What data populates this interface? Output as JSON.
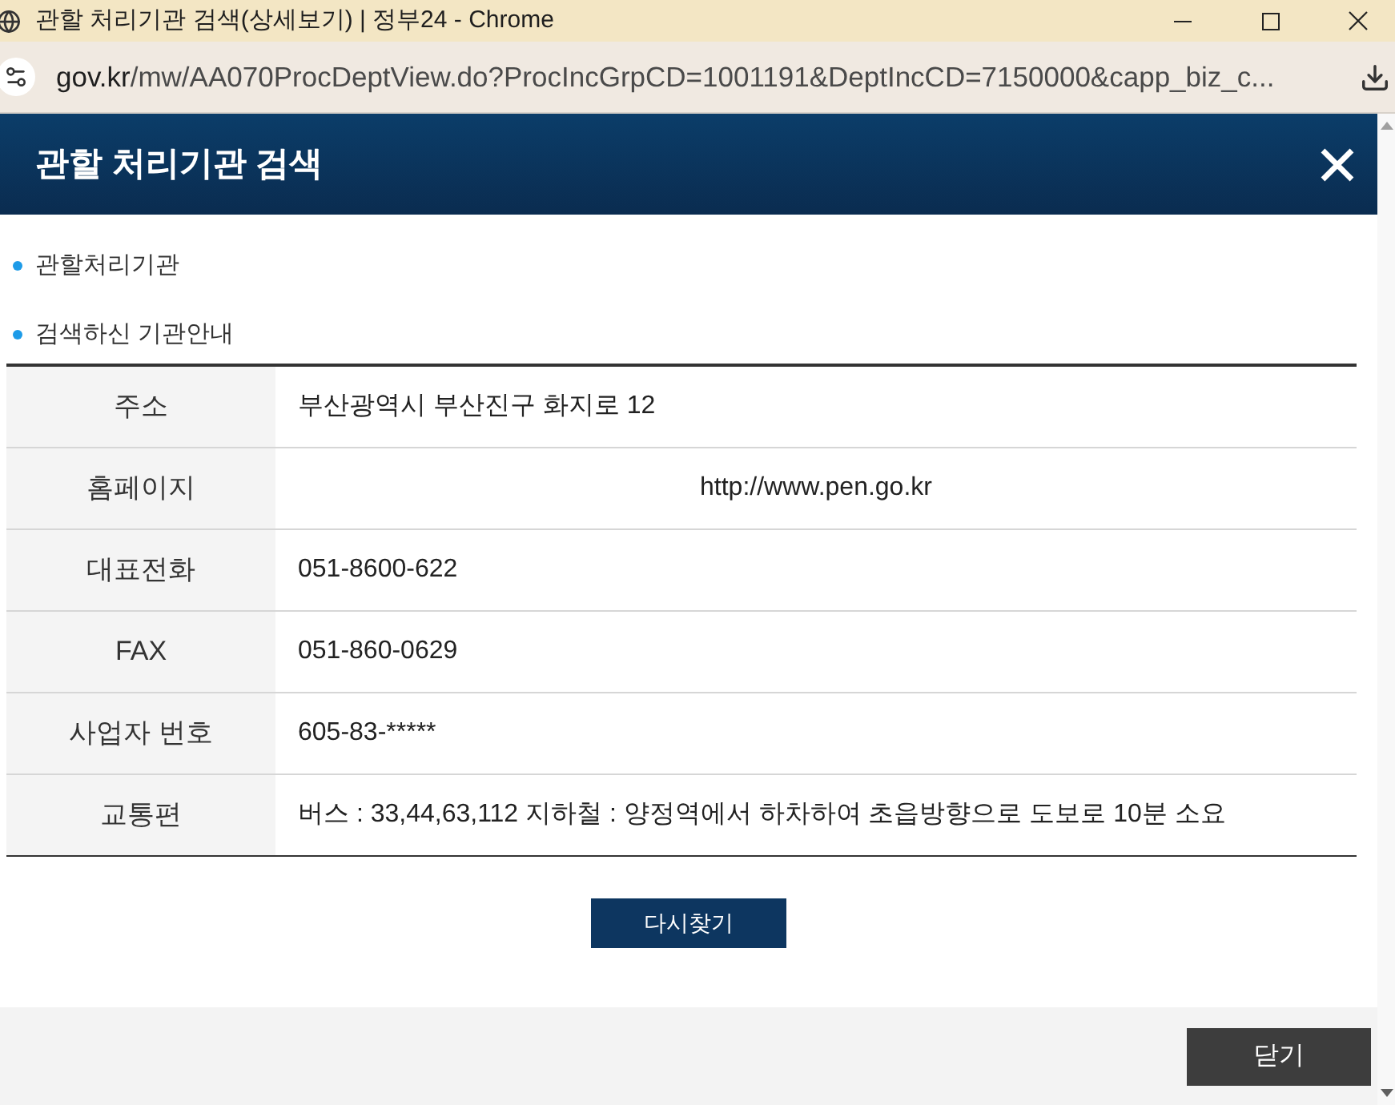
{
  "window": {
    "title": "관할 처리기관 검색(상세보기) | 정부24 - Chrome"
  },
  "address_bar": {
    "host": "gov.kr",
    "path": "/mw/AA070ProcDeptView.do?ProcIncGrpCD=1001191&DeptIncCD=7150000&capp_biz_c..."
  },
  "dialog": {
    "title": "관할 처리기관 검색"
  },
  "sections": [
    "관할처리기관",
    "검색하신 기관안내"
  ],
  "info_table": {
    "rows": [
      {
        "label": "주소",
        "value": "부산광역시 부산진구 화지로 12",
        "kind": "text"
      },
      {
        "label": "홈페이지",
        "value": "http://www.pen.go.kr",
        "kind": "url"
      },
      {
        "label": "대표전화",
        "value": "051-8600-622",
        "kind": "text"
      },
      {
        "label": "FAX",
        "value": "051-860-0629",
        "kind": "text"
      },
      {
        "label": "사업자 번호",
        "value": "605-83-*****",
        "kind": "text"
      },
      {
        "label": "교통편",
        "value": "버스 : 33,44,63,112 지하철 : 양정역에서 하차하여 초읍방향으로 도보로 10분 소요",
        "kind": "text"
      }
    ]
  },
  "search_again_button": "다시찾기",
  "footer": {
    "close_button": "닫기"
  }
}
